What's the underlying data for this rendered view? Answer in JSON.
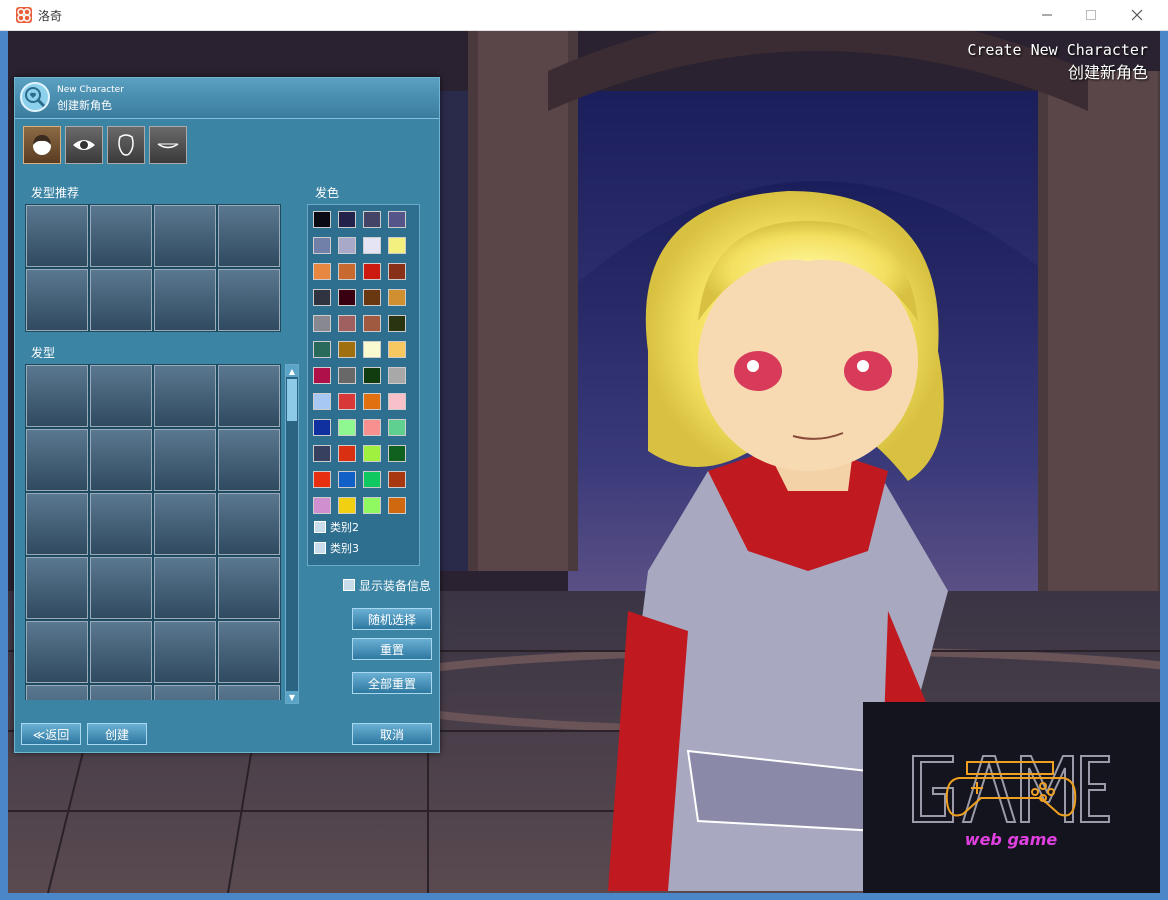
{
  "window": {
    "title": "洛奇",
    "minimize": "—",
    "maximize": "☐",
    "close": "✕"
  },
  "banner": {
    "line_en": "Create New Character",
    "line_cn": "创建新角色"
  },
  "panel": {
    "title_en": "New Character",
    "title_cn": "创建新角色",
    "tabs": [
      {
        "name": "hair-tab",
        "icon": "hair-icon"
      },
      {
        "name": "eye-tab",
        "icon": "eye-icon"
      },
      {
        "name": "face-tab",
        "icon": "face-icon"
      },
      {
        "name": "mouth-tab",
        "icon": "mouth-icon"
      }
    ],
    "recommended_label": "发型推荐",
    "hairstyle_label": "发型",
    "hair_color_label": "发色",
    "category2": "类别2",
    "category3": "类别3",
    "show_equipment": "显示装备信息",
    "random_button": "随机选择",
    "reset_button": "重置",
    "reset_all_button": "全部重置",
    "back_button": "≪返回",
    "create_button": "创建",
    "cancel_button": "取消"
  },
  "hair_colors": [
    "#0a0a14",
    "#22224a",
    "#444466",
    "#55558a",
    "#7080a8",
    "#a8a8c8",
    "#e4e4f4",
    "#f4f080",
    "#e88840",
    "#c86a30",
    "#cc1a10",
    "#883018",
    "#303440",
    "#380010",
    "#6a3810",
    "#d09030",
    "#888890",
    "#a06060",
    "#a05a40",
    "#2a3410",
    "#2a6a5a",
    "#a07010",
    "#fafad0",
    "#f8c860",
    "#b0104a",
    "#686868",
    "#103c10",
    "#a8a8a8",
    "#a8c8f4",
    "#d83838",
    "#e07010",
    "#f8c0c8",
    "#1030a0",
    "#90f890",
    "#f89090",
    "#60d090",
    "#384060",
    "#d83010",
    "#a0f040",
    "#106020",
    "#e83010",
    "#1060c8",
    "#10c860",
    "#a83810",
    "#d090d0",
    "#f0d010",
    "#90f860",
    "#d06810"
  ],
  "game_logo": {
    "big": "GAME",
    "small": "web game"
  }
}
